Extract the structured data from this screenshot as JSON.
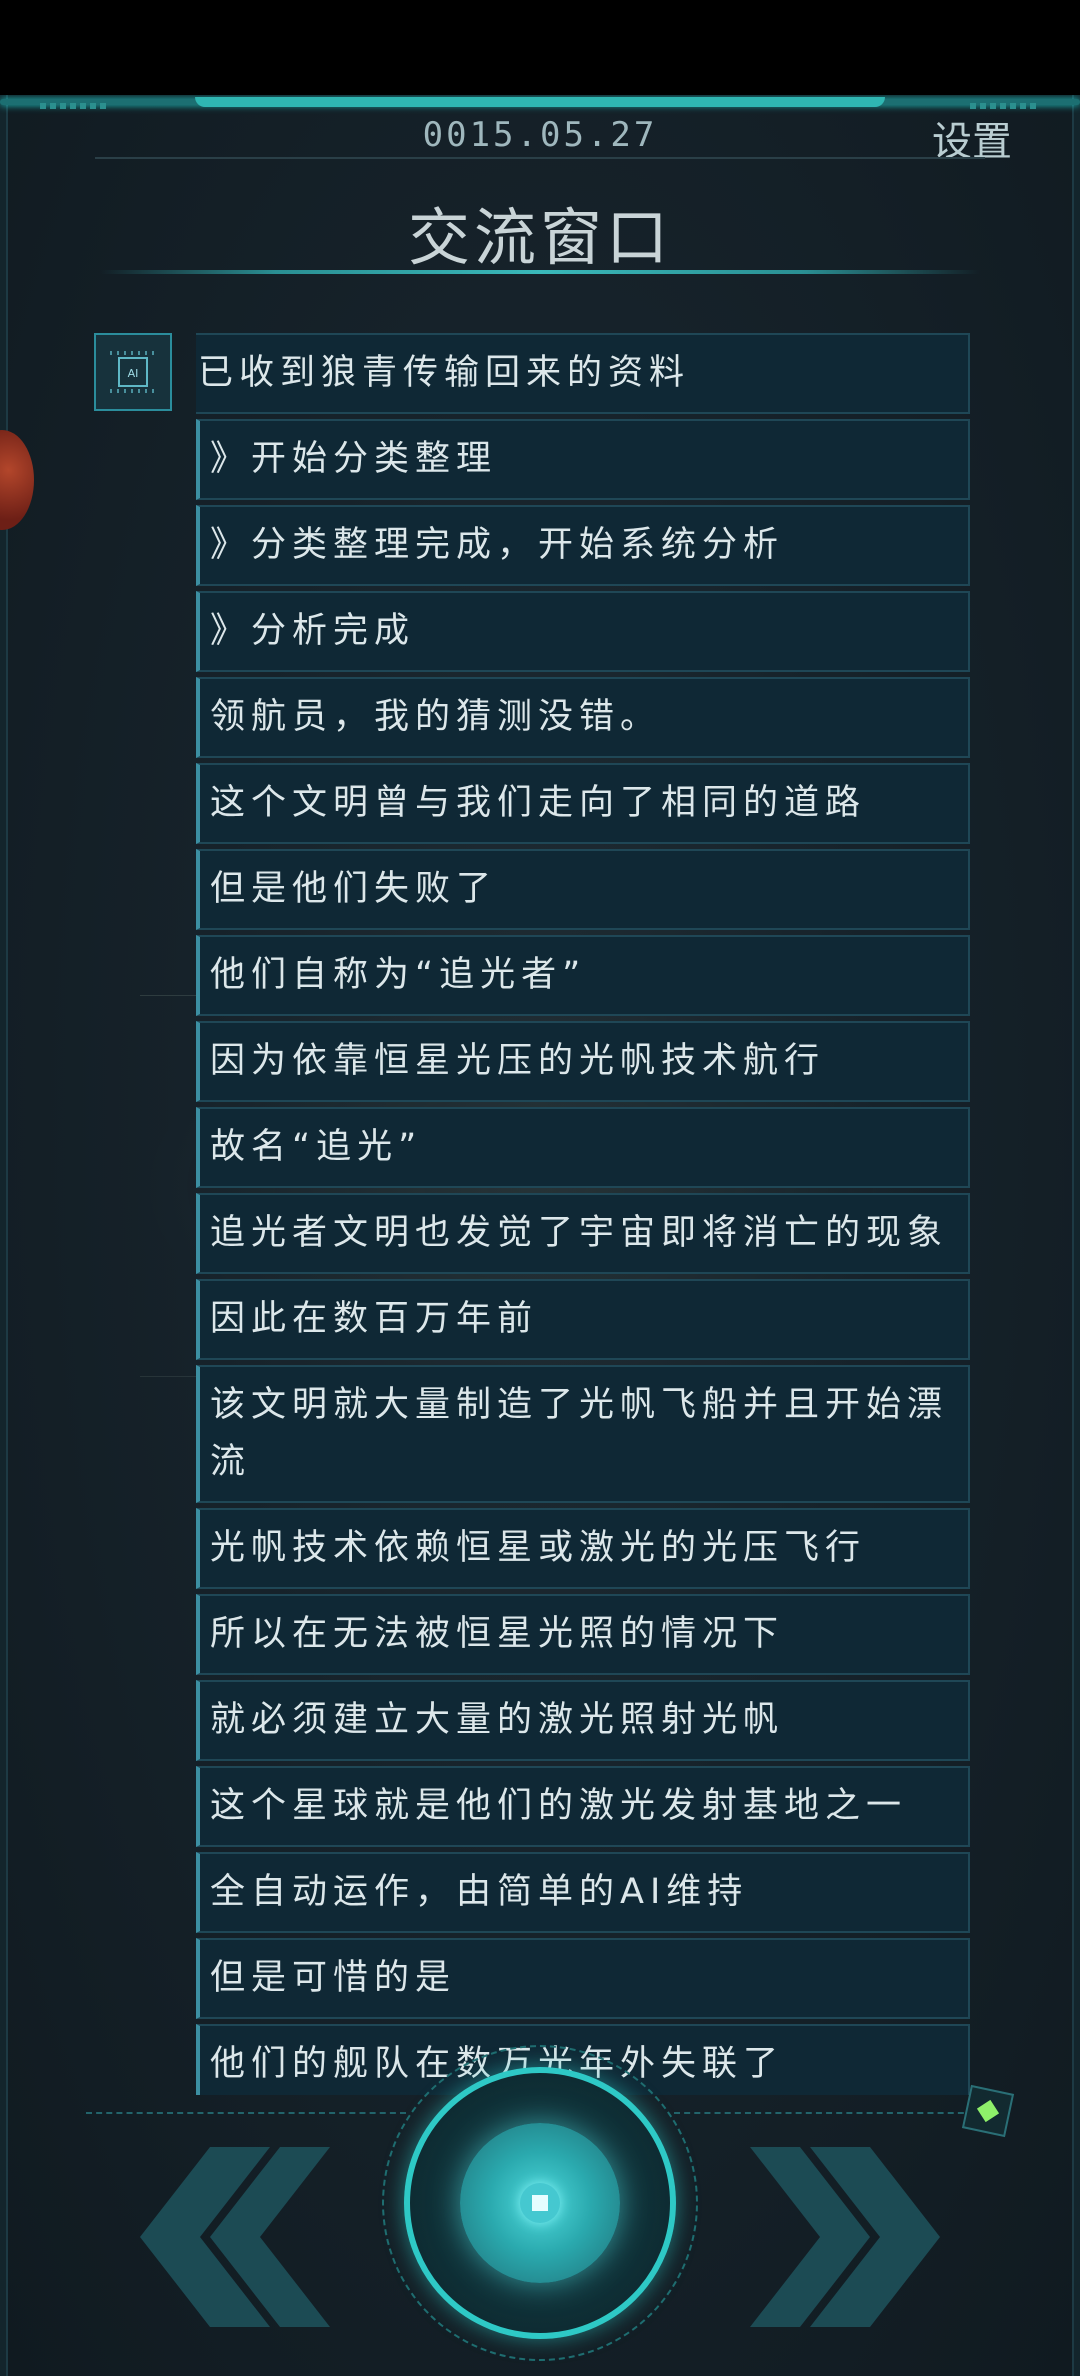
{
  "header": {
    "date": "0015.05.27",
    "settings_label": "设置",
    "title": "交流窗口"
  },
  "ai_icon_label": "AI",
  "messages": [
    "已收到狼青传输回来的资料",
    "》开始分类整理",
    "》分类整理完成，开始系统分析",
    "》分析完成",
    "领航员，我的猜测没错。",
    "这个文明曾与我们走向了相同的道路",
    "但是他们失败了",
    "他们自称为“追光者”",
    "因为依靠恒星光压的光帆技术航行",
    "故名“追光”",
    "追光者文明也发觉了宇宙即将消亡的现象",
    "因此在数百万年前",
    "该文明就大量制造了光帆飞船并且开始漂流",
    "光帆技术依赖恒星或激光的光压飞行",
    "所以在无法被恒星光照的情况下",
    "就必须建立大量的激光照射光帆",
    "这个星球就是他们的激光发射基地之一",
    "全自动运作，由简单的AI维持",
    "但是可惜的是",
    "他们的舰队在数万光年外失联了"
  ],
  "controls": {
    "left_icon": "double-chevron-left-icon",
    "center_icon": "stop-icon",
    "right_icon": "double-chevron-right-icon"
  },
  "colors": {
    "accent": "#2ec9c6",
    "panel": "#0f2835",
    "text": "#dce7ea"
  }
}
